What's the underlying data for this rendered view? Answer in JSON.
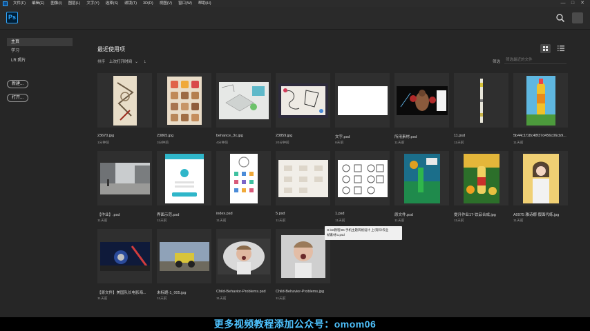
{
  "menubar": {
    "items": [
      "文件(F)",
      "编辑(E)",
      "图像(I)",
      "图层(L)",
      "文字(Y)",
      "选择(S)",
      "滤镜(T)",
      "3D(D)",
      "视图(V)",
      "窗口(W)",
      "帮助(H)"
    ],
    "controls": [
      "—",
      "□",
      "✕"
    ]
  },
  "header": {
    "logo": "Ps"
  },
  "sidebar": {
    "items": [
      "主页",
      "学习",
      "LR 照片"
    ],
    "new_button": "新建...",
    "open_button": "打开..."
  },
  "main": {
    "title": "最近使用项",
    "sort_label": "排序",
    "sort_value": "上次打开时间",
    "filter_label": "筛选",
    "filter_placeholder": "筛选最近的文件"
  },
  "files": [
    {
      "name": "23670.jpg",
      "time": "1分钟前",
      "thumb": "sketch-portrait"
    },
    {
      "name": "23865.jpg",
      "time": "3分钟前",
      "thumb": "icon-grid"
    },
    {
      "name": "behance_3x.jpg",
      "time": "4分钟前",
      "thumb": "isometric"
    },
    {
      "name": "23859.jpg",
      "time": "20分钟前",
      "thumb": "sketch-board"
    },
    {
      "name": "文字.psd",
      "time": "8天前",
      "thumb": "blank"
    },
    {
      "name": "所用素材.psd",
      "time": "11天前",
      "thumb": "boxer"
    },
    {
      "name": "11.psd",
      "time": "11天前",
      "thumb": "thin"
    },
    {
      "name": "5b44c1f18c48f37d456c06cb9...",
      "time": "11天前",
      "thumb": "bottle"
    },
    {
      "name": "【作业】.psd",
      "time": "11天前",
      "thumb": "street"
    },
    {
      "name": "界面示范.psd",
      "time": "11天前",
      "thumb": "mobile"
    },
    {
      "name": "index.psd",
      "time": "11天前",
      "thumb": "ui-icons"
    },
    {
      "name": "5.psd",
      "time": "11天前",
      "thumb": "wireframe"
    },
    {
      "name": "1.psd",
      "time": "11天前",
      "thumb": "line-icons"
    },
    {
      "name": "原文件.psd",
      "time": "11天前",
      "thumb": "game-poster"
    },
    {
      "name": "提升作业17-饮品合成.jpg",
      "time": "11天前",
      "thumb": "drink-poster"
    },
    {
      "name": "A0975 雅诗娜 假面代练.jpg",
      "time": "11天前",
      "thumb": "girl"
    },
    {
      "name": "【原文件】美国队长电影海...",
      "time": "11天前",
      "thumb": "movie-poster"
    },
    {
      "name": "未标题-1_005.jpg",
      "time": "11天前",
      "thumb": "jeep"
    },
    {
      "name": "Child-Behavior-Problems.psd",
      "time": "11天前",
      "thumb": "kid-dark"
    },
    {
      "name": "Child-Behavior-Problems.jpg",
      "time": "11天前",
      "thumb": "kid-light"
    }
  ],
  "tooltip": {
    "line1": "G:\\UI教程\\06 手机主题风格设计 上\\资料\\作业",
    "line2": "帧素材\\1.psd"
  },
  "banner": "更多视频教程添加公众号：omom06",
  "colors": {
    "accent": "#31a8ff",
    "panel": "#262626",
    "card": "#333333",
    "banner_text": "#4fc3ff"
  }
}
